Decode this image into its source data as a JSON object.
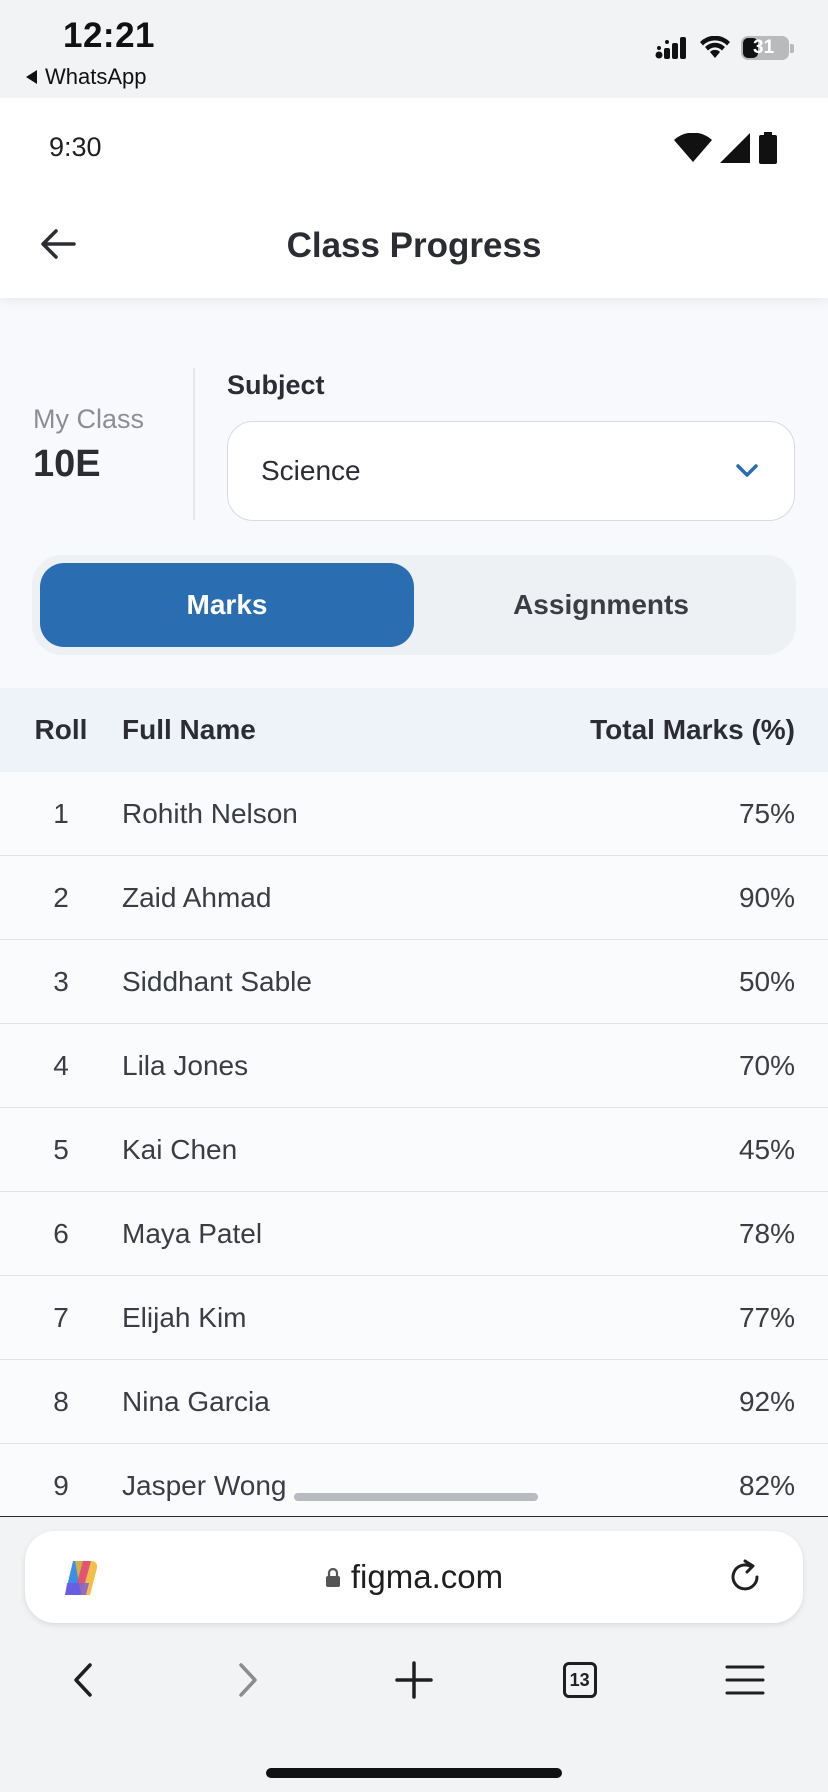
{
  "ios_status": {
    "time": "12:21",
    "back_app": "WhatsApp",
    "battery": "31"
  },
  "android_status": {
    "time": "9:30"
  },
  "header": {
    "title": "Class Progress"
  },
  "class_info": {
    "label": "My Class",
    "value": "10E"
  },
  "subject": {
    "label": "Subject",
    "selected": "Science"
  },
  "tabs": [
    {
      "label": "Marks",
      "active": true
    },
    {
      "label": "Assignments",
      "active": false
    }
  ],
  "table": {
    "headers": {
      "roll": "Roll",
      "name": "Full Name",
      "total": "Total Marks (%)"
    },
    "rows": [
      {
        "roll": "1",
        "name": "Rohith Nelson",
        "total": "75%"
      },
      {
        "roll": "2",
        "name": "Zaid Ahmad",
        "total": "90%"
      },
      {
        "roll": "3",
        "name": "Siddhant Sable",
        "total": "50%"
      },
      {
        "roll": "4",
        "name": "Lila Jones",
        "total": "70%"
      },
      {
        "roll": "5",
        "name": "Kai Chen",
        "total": "45%"
      },
      {
        "roll": "6",
        "name": "Maya Patel",
        "total": "78%"
      },
      {
        "roll": "7",
        "name": "Elijah Kim",
        "total": "77%"
      },
      {
        "roll": "8",
        "name": "Nina Garcia",
        "total": "92%"
      },
      {
        "roll": "9",
        "name": "Jasper Wong",
        "total": "82%"
      }
    ]
  },
  "browser": {
    "url": "figma.com",
    "tab_count": "13"
  },
  "colors": {
    "accent": "#2a6db1",
    "background": "#f7f9fc"
  }
}
